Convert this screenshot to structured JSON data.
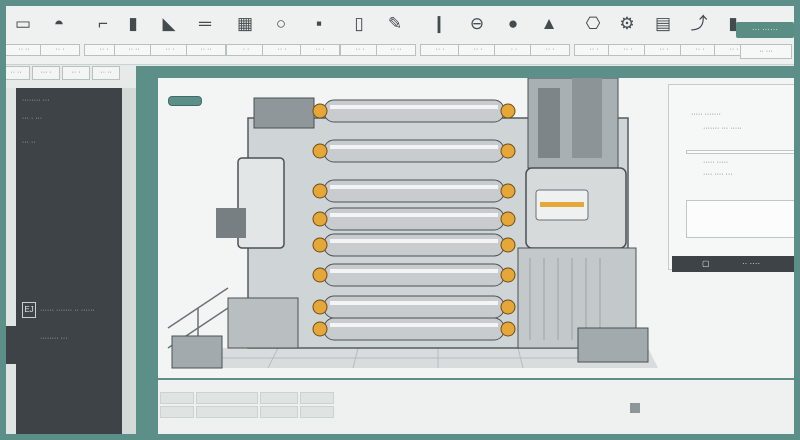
{
  "toolbar": {
    "tools": [
      {
        "icon": "folder-icon",
        "glyph": "▭",
        "label": "·· ··"
      },
      {
        "icon": "camera-icon",
        "glyph": "◓",
        "label": "·· ·"
      },
      {
        "icon": "probe-icon",
        "glyph": "⌐",
        "label": "·· ·"
      },
      {
        "icon": "document-icon",
        "glyph": "▮",
        "label": "·· ··"
      },
      {
        "icon": "tag-icon",
        "glyph": "◣",
        "label": "·· ·"
      },
      {
        "icon": "ruler-icon",
        "glyph": "═",
        "label": "·· ··"
      },
      {
        "icon": "grid-icon",
        "glyph": "▦",
        "label": "· ·"
      },
      {
        "icon": "circle-icon",
        "glyph": "○",
        "label": "·· ·"
      },
      {
        "icon": "box-icon",
        "glyph": "▪",
        "label": "·· ·"
      },
      {
        "icon": "tube-icon",
        "glyph": "▯",
        "label": "·· ·"
      },
      {
        "icon": "pen-icon",
        "glyph": "✎",
        "label": "·· ··"
      },
      {
        "icon": "bar-icon",
        "glyph": "❙",
        "label": "·· ·"
      },
      {
        "icon": "lock-icon",
        "glyph": "⊖",
        "label": "·· ·"
      },
      {
        "icon": "dot-icon",
        "glyph": "●",
        "label": "· ·"
      },
      {
        "icon": "warning-icon",
        "glyph": "▲",
        "label": "·· ·"
      },
      {
        "icon": "link-icon",
        "glyph": "⎔",
        "label": "·· ·"
      },
      {
        "icon": "cog-icon",
        "glyph": "⚙",
        "label": "·· ·"
      },
      {
        "icon": "layers-icon",
        "glyph": "▤",
        "label": "·· ·"
      },
      {
        "icon": "share-icon",
        "glyph": "⤴",
        "label": "·· ·"
      },
      {
        "icon": "flag-icon",
        "glyph": "▮",
        "label": "·· ·"
      }
    ],
    "primary_button": "··· ······",
    "secondary_button": "·· ···"
  },
  "crumbs": [
    "·· ··",
    "··· ·",
    "·· ·",
    "·· ··"
  ],
  "sidebar": {
    "items": [
      "········ ···",
      "··· · ···",
      "··· ··"
    ],
    "footer_icon": "EJ",
    "footer_items": [
      "······ ······· ·· ······",
      "········ ···"
    ]
  },
  "panel": {
    "lines": [
      "····· ·······",
      "······· ··· ·····",
      "····· ·····",
      "···· ···· ···",
      "··· ··· ·· ·",
      "··· ·· ···"
    ],
    "bar_left": "▢",
    "bar_right": "·· ····"
  },
  "colors": {
    "accent": "#5c8f88",
    "dark": "#3d4346",
    "canvas": "#f3f5f4",
    "roller": "#c8ccce",
    "gold": "#e5a73a"
  }
}
